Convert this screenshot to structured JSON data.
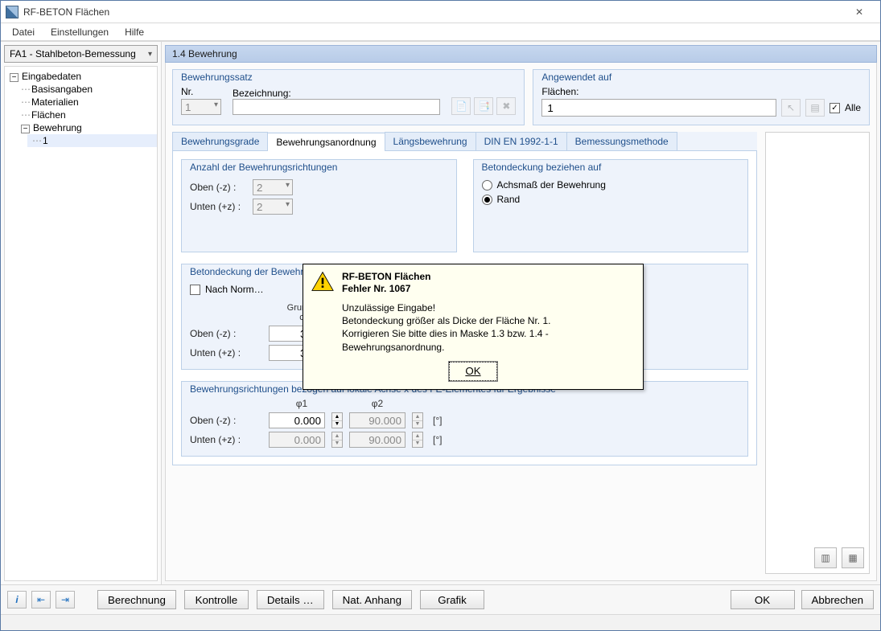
{
  "window": {
    "title": "RF-BETON Flächen"
  },
  "menu": {
    "file": "Datei",
    "settings": "Einstellungen",
    "help": "Hilfe"
  },
  "case": "FA1 - Stahlbeton-Bemessung",
  "tree": {
    "root": "Eingabedaten",
    "items": [
      "Basisangaben",
      "Materialien",
      "Flächen"
    ],
    "node": "Bewehrung",
    "leaf": "1"
  },
  "panel": {
    "title": "1.4 Bewehrung"
  },
  "bewehrungssatz": {
    "legend": "Bewehrungssatz",
    "nr_label": "Nr.",
    "nr_value": "1",
    "bez_label": "Bezeichnung:",
    "bez_value": ""
  },
  "angewendet": {
    "legend": "Angewendet auf",
    "label": "Flächen:",
    "value": "1",
    "alle": "Alle"
  },
  "tabs": {
    "t1": "Bewehrungsgrade",
    "t2": "Bewehrungsanordnung",
    "t3": "Längsbewehrung",
    "t4": "DIN EN 1992-1-1",
    "t5": "Bemessungsmethode"
  },
  "anzahl": {
    "legend": "Anzahl der Bewehrungsrichtungen",
    "oben": "Oben (-z) :",
    "unten": "Unten (+z) :",
    "oben_val": "2",
    "unten_val": "2"
  },
  "betonbez": {
    "legend": "Betondeckung beziehen auf",
    "opt1": "Achsmaß der Bewehrung",
    "opt2": "Rand"
  },
  "betondeckung": {
    "legend": "Betondeckung der Bewehrung",
    "nachnorm": "Nach Norm…",
    "grund_label": "Grundb",
    "c_label": "c",
    "oben": "Oben (-z) :",
    "unten": "Unten (+z) :",
    "oben_val": "3.00",
    "unten_val": "3.00"
  },
  "richtungen": {
    "legend": "Bewehrungsrichtungen bezogen auf lokale Achse x des FE-Elementes für Ergebnisse",
    "phi1": "φ1",
    "phi2": "φ2",
    "unit": "[°]",
    "oben": "Oben (-z) :",
    "unten": "Unten (+z) :",
    "v11": "0.000",
    "v12": "90.000",
    "v21": "0.000",
    "v22": "90.000"
  },
  "footer": {
    "calc": "Berechnung",
    "kontrolle": "Kontrolle",
    "details": "Details …",
    "nat": "Nat. Anhang",
    "grafik": "Grafik",
    "ok": "OK",
    "cancel": "Abbrechen"
  },
  "modal": {
    "title1": "RF-BETON Flächen",
    "title2": "Fehler Nr. 1067",
    "line1": "Unzulässige Eingabe!",
    "line2": "Betondeckung größer als Dicke der Fläche Nr. 1.",
    "line3": "Korrigieren Sie bitte dies in Maske 1.3 bzw. 1.4 - Bewehrungsanordnung.",
    "ok": "OK"
  }
}
